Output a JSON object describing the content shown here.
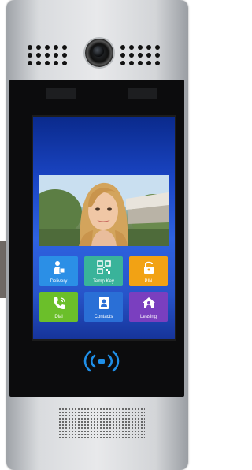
{
  "device": {
    "icons": [
      "speaker-holes",
      "camera-lens",
      "nfc-reader-icon",
      "speaker-grille"
    ]
  },
  "screen": {
    "tiles": [
      {
        "label": "Delivery",
        "color": "#2b8fe6",
        "icon": "delivery-person-icon"
      },
      {
        "label": "Temp Key",
        "color": "#39b39a",
        "icon": "qr-code-icon"
      },
      {
        "label": "PIN",
        "color": "#f2a214",
        "icon": "padlock-icon"
      },
      {
        "label": "Dial",
        "color": "#6bbf2a",
        "icon": "phone-call-icon"
      },
      {
        "label": "Contacts",
        "color": "#2a6fd6",
        "icon": "contacts-card-icon"
      },
      {
        "label": "Leasing",
        "color": "#7a3fbf",
        "icon": "house-person-icon"
      }
    ]
  }
}
